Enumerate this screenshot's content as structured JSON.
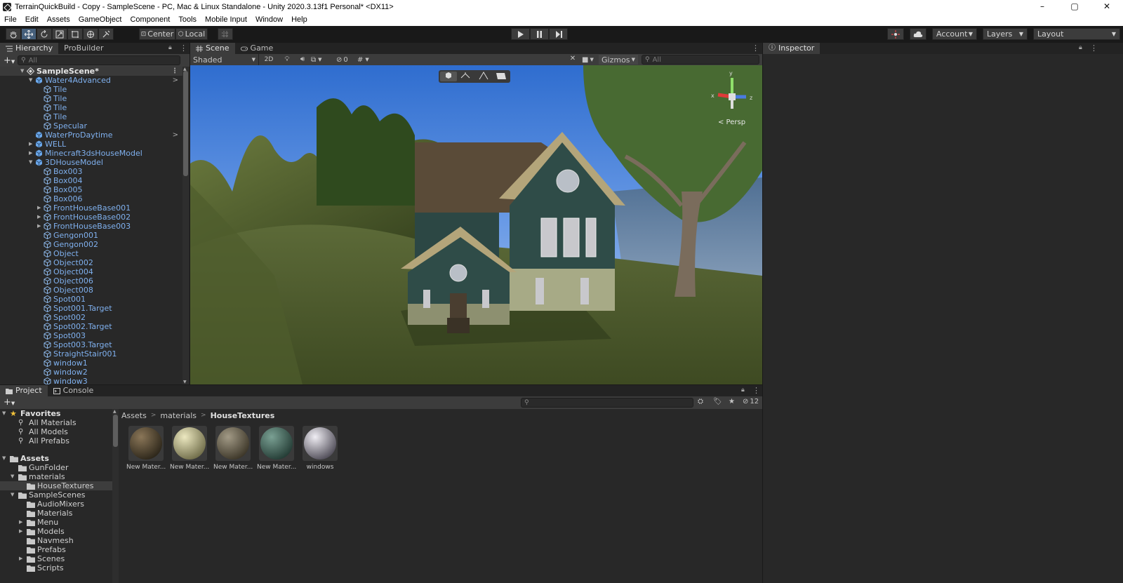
{
  "window": {
    "title": "TerrainQuickBuild - Copy - SampleScene - PC, Mac & Linux Standalone - Unity 2020.3.13f1 Personal* <DX11>",
    "min": "–",
    "max": "▢",
    "close": "✕"
  },
  "menu": [
    "File",
    "Edit",
    "Assets",
    "GameObject",
    "Component",
    "Tools",
    "Mobile Input",
    "Window",
    "Help"
  ],
  "toolbar": {
    "pivot": "Center",
    "space": "Local",
    "account": "Account",
    "layers": "Layers",
    "layout": "Layout"
  },
  "hierarchy": {
    "tabs": [
      "Hierarchy",
      "ProBuilder"
    ],
    "search_placeholder": "All",
    "rows": [
      {
        "label": "SampleScene*",
        "depth": 0,
        "expanded": true,
        "type": "scene"
      },
      {
        "label": "Water4Advanced",
        "depth": 1,
        "expanded": true,
        "type": "prefab",
        "more": true
      },
      {
        "label": "Tile",
        "depth": 2,
        "type": "object"
      },
      {
        "label": "Tile",
        "depth": 2,
        "type": "object"
      },
      {
        "label": "Tile",
        "depth": 2,
        "type": "object"
      },
      {
        "label": "Tile",
        "depth": 2,
        "type": "object"
      },
      {
        "label": "Specular",
        "depth": 2,
        "type": "object"
      },
      {
        "label": "WaterProDaytime",
        "depth": 1,
        "type": "prefab",
        "more": true
      },
      {
        "label": "WELL",
        "depth": 1,
        "collapsed": true,
        "type": "prefab"
      },
      {
        "label": "Minecraft3dsHouseModel",
        "depth": 1,
        "collapsed": true,
        "type": "prefab"
      },
      {
        "label": "3DHouseModel",
        "depth": 1,
        "expanded": true,
        "type": "prefab"
      },
      {
        "label": "Box003",
        "depth": 2,
        "type": "object"
      },
      {
        "label": "Box004",
        "depth": 2,
        "type": "object"
      },
      {
        "label": "Box005",
        "depth": 2,
        "type": "object"
      },
      {
        "label": "Box006",
        "depth": 2,
        "type": "object"
      },
      {
        "label": "FrontHouseBase001",
        "depth": 2,
        "collapsed": true,
        "type": "object"
      },
      {
        "label": "FrontHouseBase002",
        "depth": 2,
        "collapsed": true,
        "type": "object"
      },
      {
        "label": "FrontHouseBase003",
        "depth": 2,
        "collapsed": true,
        "type": "object"
      },
      {
        "label": "Gengon001",
        "depth": 2,
        "type": "object"
      },
      {
        "label": "Gengon002",
        "depth": 2,
        "type": "object"
      },
      {
        "label": "Object",
        "depth": 2,
        "type": "object"
      },
      {
        "label": "Object002",
        "depth": 2,
        "type": "object"
      },
      {
        "label": "Object004",
        "depth": 2,
        "type": "object"
      },
      {
        "label": "Object006",
        "depth": 2,
        "type": "object"
      },
      {
        "label": "Object008",
        "depth": 2,
        "type": "object"
      },
      {
        "label": "Spot001",
        "depth": 2,
        "type": "object"
      },
      {
        "label": "Spot001.Target",
        "depth": 2,
        "type": "object"
      },
      {
        "label": "Spot002",
        "depth": 2,
        "type": "object"
      },
      {
        "label": "Spot002.Target",
        "depth": 2,
        "type": "object"
      },
      {
        "label": "Spot003",
        "depth": 2,
        "type": "object"
      },
      {
        "label": "Spot003.Target",
        "depth": 2,
        "type": "object"
      },
      {
        "label": "StraightStair001",
        "depth": 2,
        "type": "object"
      },
      {
        "label": "window1",
        "depth": 2,
        "type": "object"
      },
      {
        "label": "window2",
        "depth": 2,
        "type": "object"
      },
      {
        "label": "window3",
        "depth": 2,
        "type": "object"
      }
    ]
  },
  "scene": {
    "tabs": [
      "Scene",
      "Game"
    ],
    "shading": "Shaded",
    "mode2d": "2D",
    "hidden_count": "0",
    "gizmos": "Gizmos",
    "search_placeholder": "All",
    "persp_label": "< Persp"
  },
  "inspector": {
    "tab": "Inspector"
  },
  "project": {
    "tabs": [
      "Project",
      "Console"
    ],
    "hidden_count": "12",
    "tree": [
      {
        "label": "Favorites",
        "depth": 0,
        "expanded": true,
        "bold": true,
        "icon": "star-icon"
      },
      {
        "label": "All Materials",
        "depth": 1,
        "icon": "search-icon"
      },
      {
        "label": "All Models",
        "depth": 1,
        "icon": "search-icon"
      },
      {
        "label": "All Prefabs",
        "depth": 1,
        "icon": "search-icon"
      },
      {
        "label": "",
        "depth": 0,
        "spacer": true
      },
      {
        "label": "Assets",
        "depth": 0,
        "expanded": true,
        "bold": true,
        "icon": "folder-icon"
      },
      {
        "label": "GunFolder",
        "depth": 1,
        "icon": "folder-icon"
      },
      {
        "label": "materials",
        "depth": 1,
        "expanded": true,
        "icon": "folder-icon"
      },
      {
        "label": "HouseTextures",
        "depth": 2,
        "icon": "folder-icon",
        "selected": true
      },
      {
        "label": "SampleScenes",
        "depth": 1,
        "expanded": true,
        "icon": "folder-icon"
      },
      {
        "label": "AudioMixers",
        "depth": 2,
        "icon": "folder-icon"
      },
      {
        "label": "Materials",
        "depth": 2,
        "icon": "folder-icon"
      },
      {
        "label": "Menu",
        "depth": 2,
        "collapsed": true,
        "icon": "folder-icon"
      },
      {
        "label": "Models",
        "depth": 2,
        "collapsed": true,
        "icon": "folder-icon"
      },
      {
        "label": "Navmesh",
        "depth": 2,
        "icon": "folder-icon"
      },
      {
        "label": "Prefabs",
        "depth": 2,
        "icon": "folder-icon"
      },
      {
        "label": "Scenes",
        "depth": 2,
        "collapsed": true,
        "icon": "folder-icon"
      },
      {
        "label": "Scripts",
        "depth": 2,
        "icon": "folder-icon"
      }
    ],
    "breadcrumb": [
      "Assets",
      "materials",
      "HouseTextures"
    ],
    "assets": [
      {
        "label": "New Mater...",
        "color_a": "#8a7658",
        "color_b": "#2a2418"
      },
      {
        "label": "New Mater...",
        "color_a": "#ece8c0",
        "color_b": "#6d6a47"
      },
      {
        "label": "New Mater...",
        "color_a": "#a29a86",
        "color_b": "#3a3426"
      },
      {
        "label": "New Mater...",
        "color_a": "#7aa093",
        "color_b": "#223a33"
      },
      {
        "label": "windows",
        "color_a": "#f0eef4",
        "color_b": "#4d4a55"
      }
    ]
  },
  "colors": {
    "accent": "#46607c",
    "prefab_text": "#7fb0ee"
  }
}
